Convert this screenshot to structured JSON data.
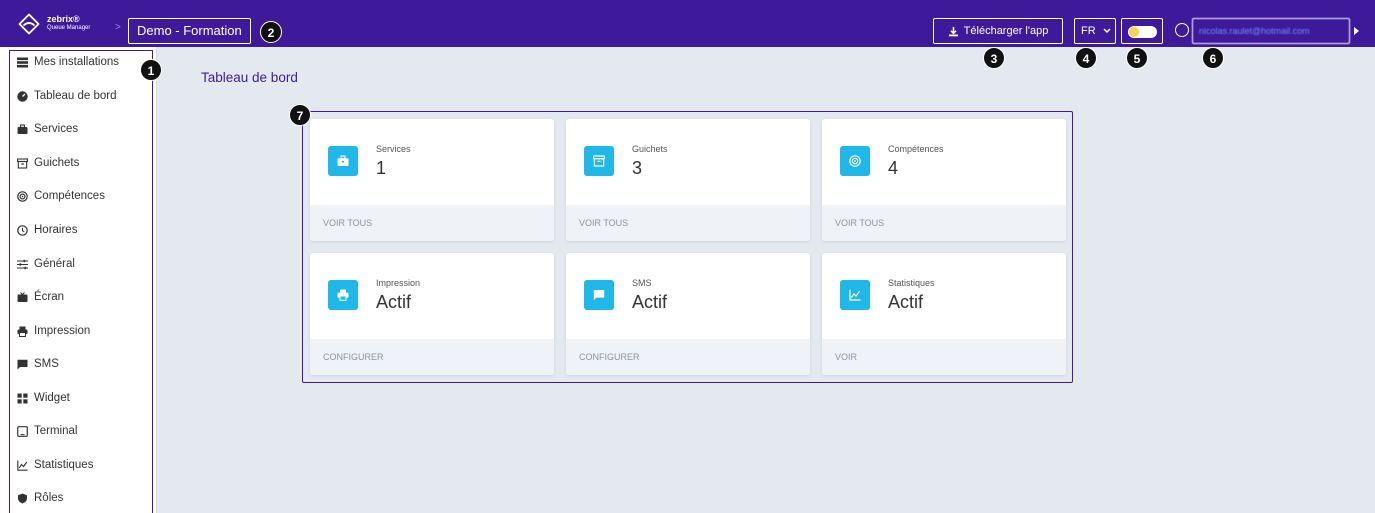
{
  "header": {
    "brand_name": "zebrix®",
    "brand_sub": "Queue Manager",
    "breadcrumb_sep": ">",
    "project_name": "Demo - Formation",
    "download_label": "Télécharger l'app",
    "language": "FR",
    "user_email": "nicolas.raulet@hotmail.com",
    "colors": {
      "bar": "#3e1a9a",
      "accent": "#1fb8e9"
    }
  },
  "sidebar": {
    "items": [
      {
        "label": "Mes installations",
        "icon": "server-icon"
      },
      {
        "label": "Tableau de bord",
        "icon": "dashboard-icon"
      },
      {
        "label": "Services",
        "icon": "briefcase-icon"
      },
      {
        "label": "Guichets",
        "icon": "archive-icon"
      },
      {
        "label": "Compétences",
        "icon": "target-icon"
      },
      {
        "label": "Horaires",
        "icon": "clock-icon"
      },
      {
        "label": "Général",
        "icon": "sliders-icon"
      },
      {
        "label": "Écran",
        "icon": "tv-icon"
      },
      {
        "label": "Impression",
        "icon": "printer-icon"
      },
      {
        "label": "SMS",
        "icon": "message-icon"
      },
      {
        "label": "Widget",
        "icon": "widget-icon"
      },
      {
        "label": "Terminal",
        "icon": "tablet-icon"
      },
      {
        "label": "Statistiques",
        "icon": "chart-icon"
      },
      {
        "label": "Rôles",
        "icon": "shield-icon"
      }
    ]
  },
  "main": {
    "title": "Tableau de bord",
    "cards": [
      {
        "title": "Services",
        "value": "1",
        "action": "VOIR TOUS",
        "icon": "briefcase-icon"
      },
      {
        "title": "Guichets",
        "value": "3",
        "action": "VOIR TOUS",
        "icon": "archive-icon"
      },
      {
        "title": "Compétences",
        "value": "4",
        "action": "VOIR TOUS",
        "icon": "target-icon"
      },
      {
        "title": "Impression",
        "value": "Actif",
        "action": "CONFIGURER",
        "icon": "printer-icon"
      },
      {
        "title": "SMS",
        "value": "Actif",
        "action": "CONFIGURER",
        "icon": "message-icon"
      },
      {
        "title": "Statistiques",
        "value": "Actif",
        "action": "VOIR",
        "icon": "chart-icon"
      }
    ]
  },
  "annotations": [
    "1",
    "2",
    "3",
    "4",
    "5",
    "6",
    "7"
  ]
}
